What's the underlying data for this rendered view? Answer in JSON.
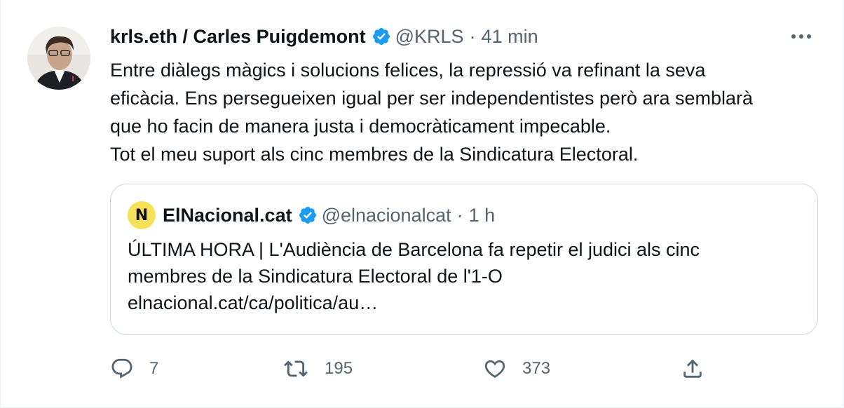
{
  "author": {
    "name": "krls.eth / Carles Puigdemont",
    "handle": "@KRLS",
    "separator": "·",
    "time": "41 min"
  },
  "tweet_lines": [
    "Entre diàlegs màgics i solucions felices, la repressió va refinant la seva",
    "eficàcia. Ens persegueixen igual per ser independentistes però ara semblarà",
    "que ho facin de manera justa i democràticament impecable.",
    "Tot el meu suport als cinc membres de la Sindicatura Electoral."
  ],
  "quoted": {
    "logo_letter": "N",
    "name": "ElNacional.cat",
    "handle": "@elnacionalcat",
    "separator": "·",
    "time": "1 h",
    "lines": [
      "ÚLTIMA HORA | L'Audiència de Barcelona fa repetir el judici als cinc",
      "membres de la Sindicatura Electoral de l'1-O",
      "elnacional.cat/ca/politica/au…"
    ]
  },
  "actions": {
    "reply_count": "7",
    "retweet_count": "195",
    "like_count": "373"
  },
  "icons": {
    "verified": "verified-badge-icon",
    "more": "more-options-icon",
    "reply": "reply-icon",
    "retweet": "retweet-icon",
    "like": "heart-icon",
    "share": "share-icon"
  },
  "colors": {
    "verified": "#1d9bf0",
    "text": "#0f1419",
    "secondary": "#536471",
    "border": "#cfd9de",
    "logo_bg": "#f7e15a"
  }
}
